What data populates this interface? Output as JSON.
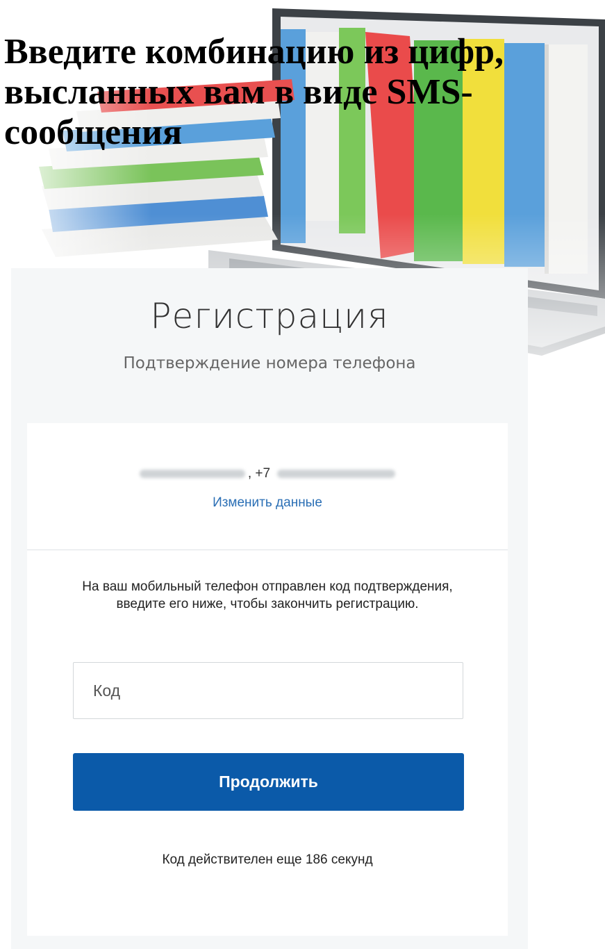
{
  "headline": {
    "text": "Введите комбинацию из цифр, высланных вам в виде SMS-сообщения"
  },
  "registration": {
    "title": "Регистрация",
    "subtitle": "Подтверждение номера телефона",
    "user_info": {
      "phone_prefix": ", +7"
    },
    "edit_link": "Изменить данные",
    "instruction": "На ваш мобильный телефон отправлен код подтверждения, введите его ниже, чтобы закончить регистрацию.",
    "code_field": {
      "placeholder": "Код",
      "value": ""
    },
    "continue_label": "Продолжить",
    "timer_text": "Код действителен еще 186 секунд"
  },
  "colors": {
    "accent": "#0b5aa9",
    "link": "#2b6fb5",
    "panel_bg": "#f5f7f8",
    "card_bg": "#ffffff"
  },
  "illustration": {
    "icons": [
      "laptop-icon",
      "books-icon"
    ]
  }
}
